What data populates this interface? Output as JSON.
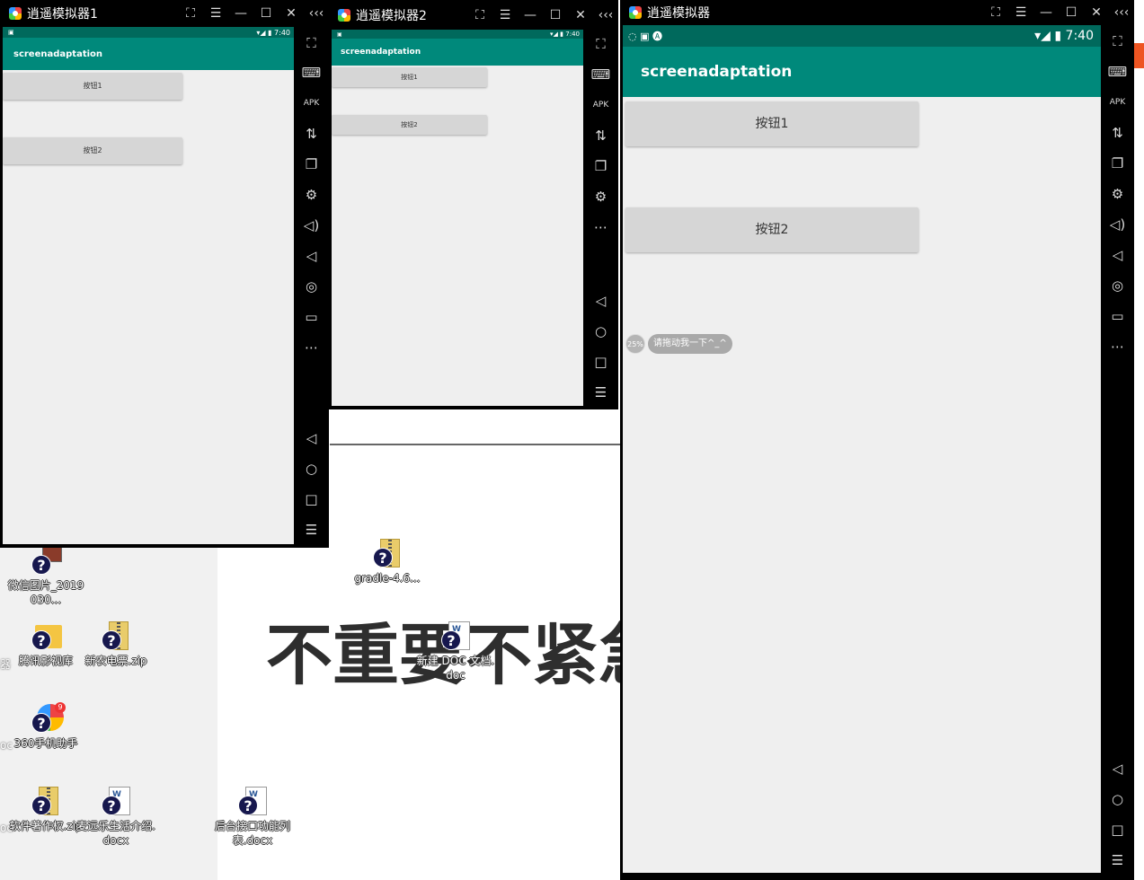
{
  "desktop": {
    "big_text": "不重要不紧急",
    "icons": [
      {
        "label": "微信图片_2019030...",
        "icon": "photo-icon"
      },
      {
        "label": "腾讯影视库",
        "icon": "folder-icon"
      },
      {
        "label": "新农电票.zip",
        "icon": "zip-icon"
      },
      {
        "label": "360手机助手",
        "icon": "360-icon",
        "badge": "9"
      },
      {
        "label": "软件著作权.zip",
        "icon": "zip-icon"
      },
      {
        "label": "麦远乐生活介绍.docx",
        "icon": "doc-icon"
      },
      {
        "label": "后台接口功能列表.docx",
        "icon": "doc-icon"
      },
      {
        "label": "gradle-4.6...",
        "icon": "zip-icon"
      },
      {
        "label": "新建 DOC 文档.doc",
        "icon": "doc-icon"
      }
    ],
    "edge_labels": [
      "器",
      "oc",
      "oc"
    ]
  },
  "emulators": [
    {
      "title": "逍遥模拟器1",
      "time": "7:40",
      "app_title": "screenadaptation",
      "buttons": [
        "按钮1",
        "按钮2"
      ]
    },
    {
      "title": "逍遥模拟器2",
      "time": "7:40",
      "app_title": "screenadaptation",
      "buttons": [
        "按钮1",
        "按钮2"
      ]
    },
    {
      "title": "逍遥模拟器",
      "time": "7:40",
      "app_title": "screenadaptation",
      "buttons": [
        "按钮1",
        "按钮2"
      ],
      "float": {
        "percent": "25%",
        "message": "请拖动我一下^_^"
      }
    }
  ],
  "titlebar_icons": [
    "fullscreen-toggle-icon",
    "menu-icon",
    "minimize-icon",
    "maximize-icon",
    "close-icon",
    "collapse-icon"
  ],
  "sidebar_icons": [
    "fullscreen-icon",
    "keyboard-icon",
    "apk-install-icon",
    "rotate-icon",
    "multi-window-icon",
    "settings-icon",
    "volume-up-icon",
    "volume-down-icon",
    "location-icon",
    "folder-icon",
    "more-icon",
    "back-icon",
    "home-icon",
    "recents-icon",
    "menu-list-icon"
  ],
  "colors": {
    "status_bar": "#00695c",
    "action_bar": "#00897b",
    "button": "#d6d6d6",
    "screen_bg": "#efefef"
  }
}
